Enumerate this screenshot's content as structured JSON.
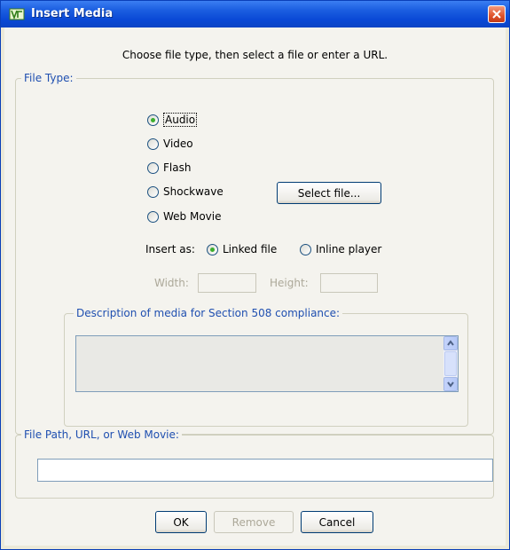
{
  "window": {
    "title": "Insert Media"
  },
  "instructions": "Choose file type, then select a file or enter a URL.",
  "file_type": {
    "legend": "File Type:",
    "options": [
      "Audio",
      "Video",
      "Flash",
      "Shockwave",
      "Web Movie"
    ],
    "selected": "Audio",
    "select_file_label": "Select file..."
  },
  "insert_as": {
    "label": "Insert as:",
    "options": [
      "Linked file",
      "Inline player"
    ],
    "selected": "Linked file"
  },
  "dimensions": {
    "width_label": "Width:",
    "height_label": "Height:"
  },
  "description": {
    "legend": "Description of media for Section 508 compliance:",
    "value": ""
  },
  "file_path": {
    "legend": "File Path, URL, or Web Movie:",
    "value": ""
  },
  "buttons": {
    "ok": "OK",
    "remove": "Remove",
    "cancel": "Cancel"
  },
  "colors": {
    "title_bar": "#0a49d6",
    "legend_text": "#1f4fb0",
    "dialog_bg": "#f4f3ee"
  }
}
